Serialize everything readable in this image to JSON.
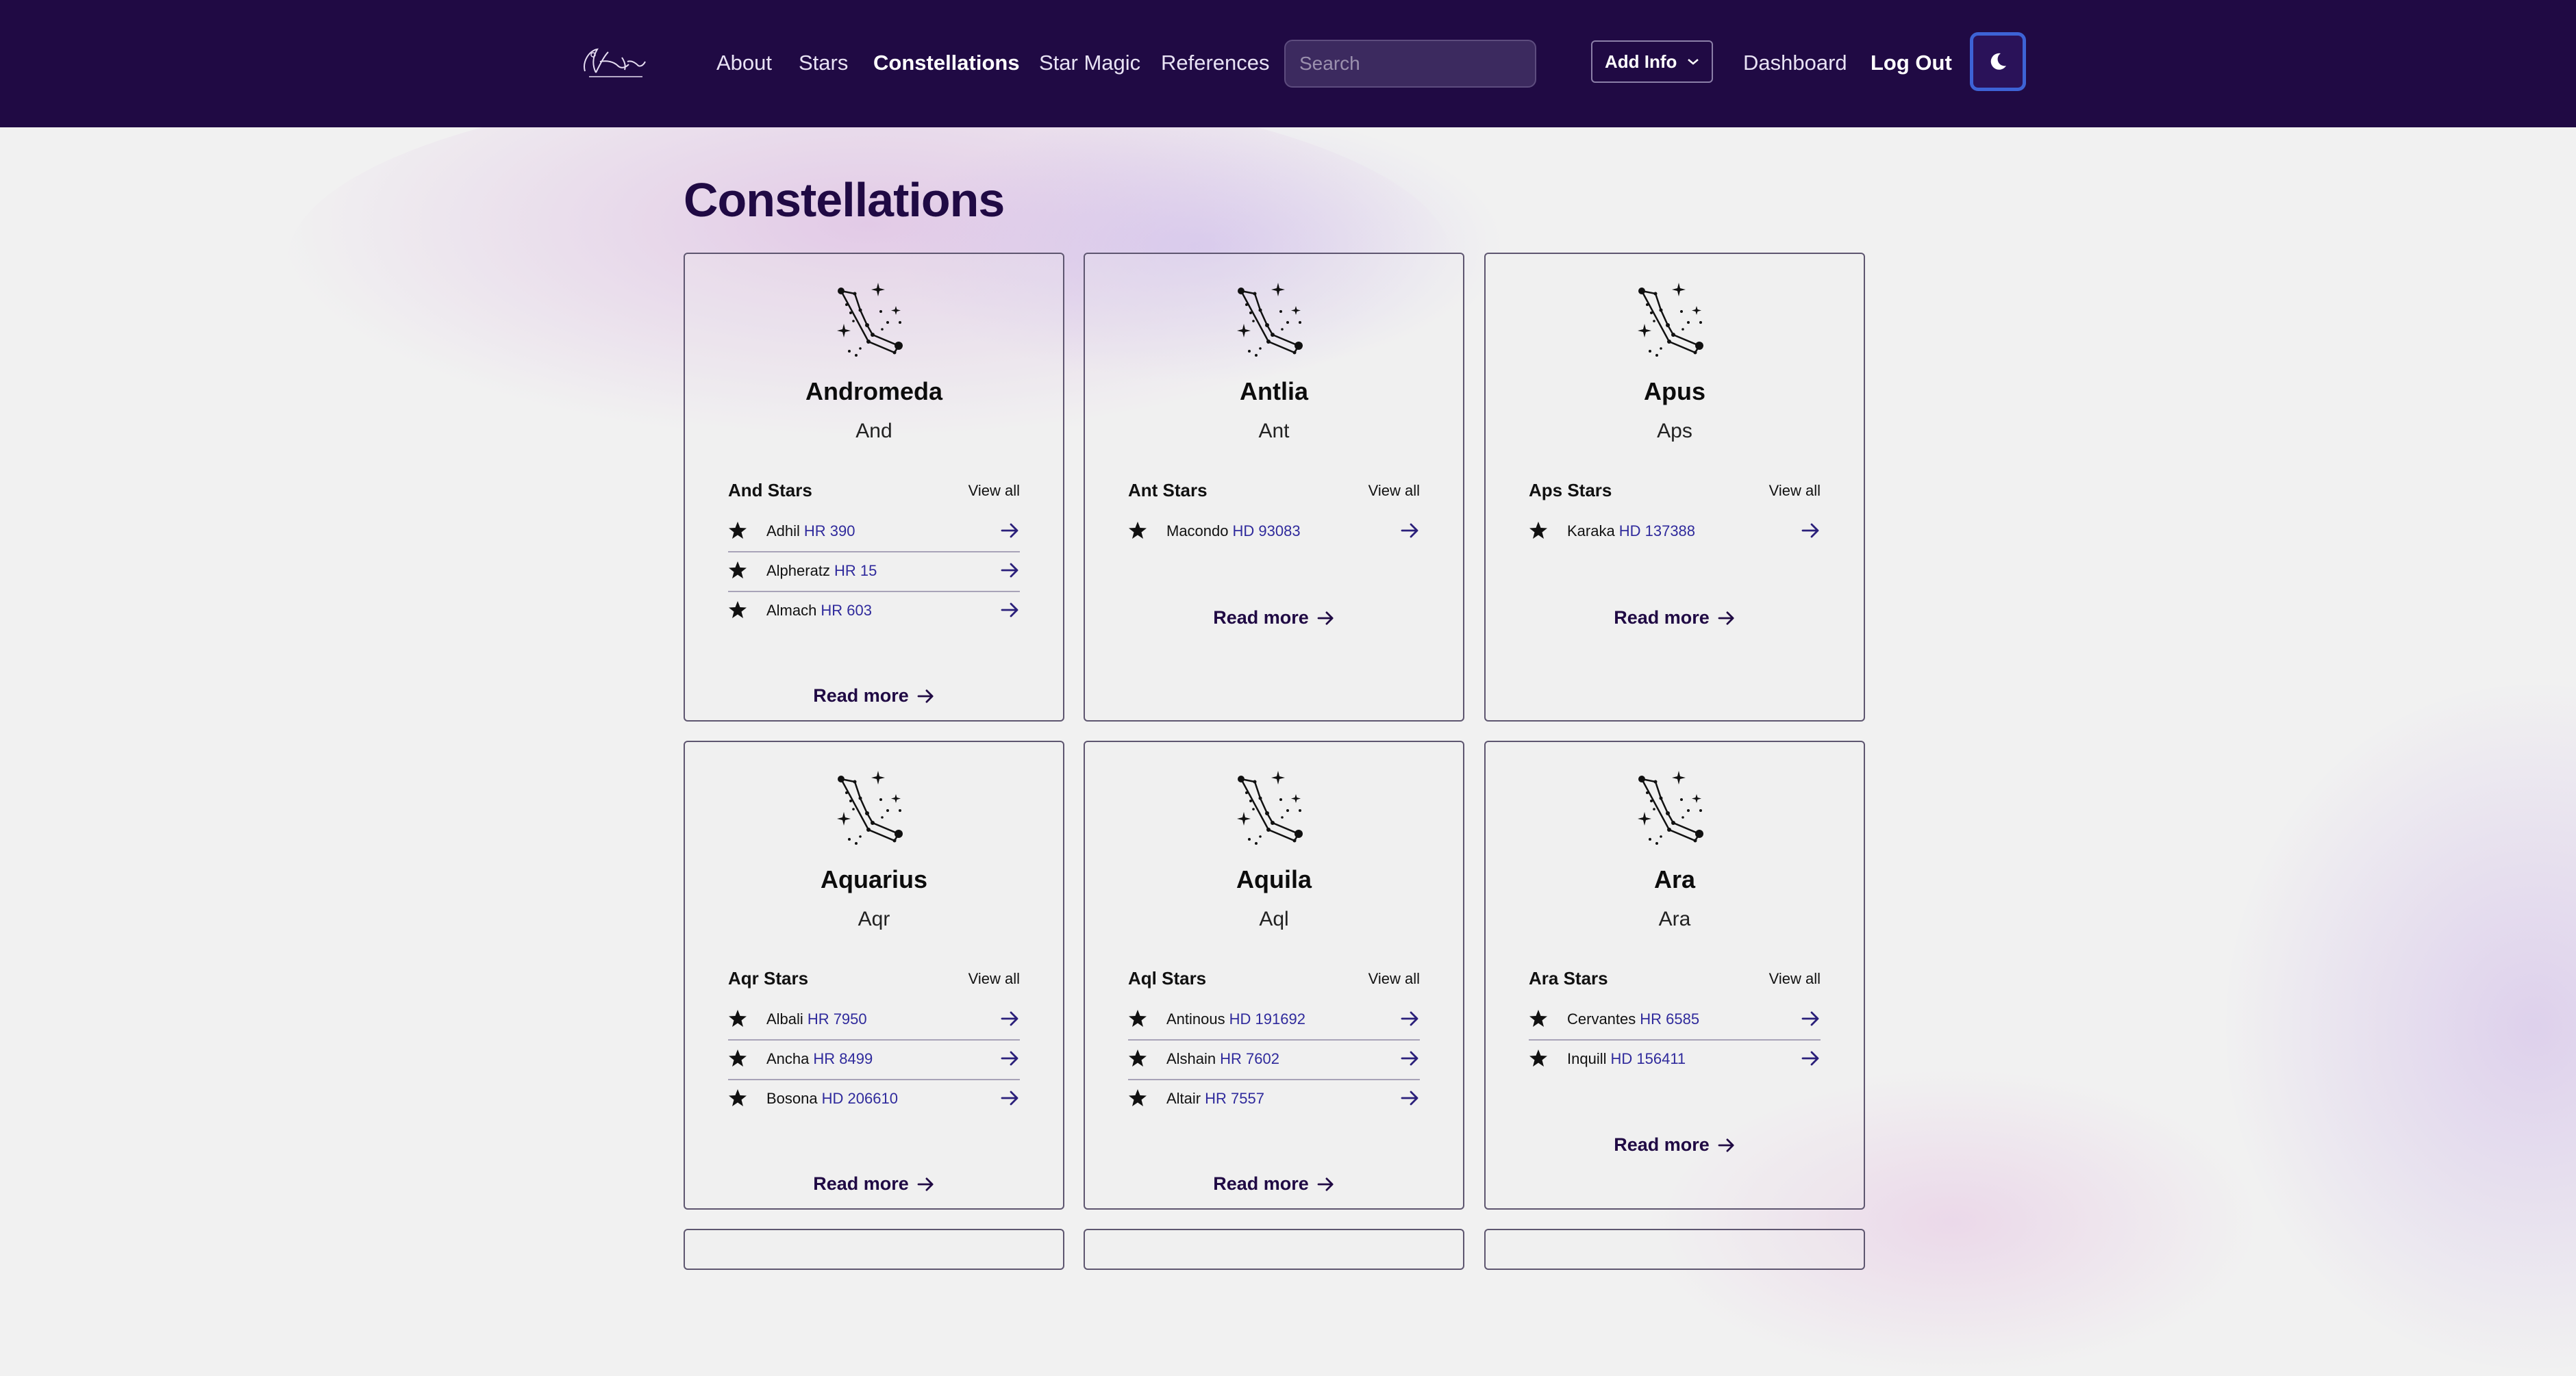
{
  "nav": {
    "links": [
      "About",
      "Stars",
      "Constellations",
      "Star Magic",
      "References"
    ],
    "search_placeholder": "Search",
    "add_info": "Add Info",
    "dashboard": "Dashboard",
    "logout": "Log Out"
  },
  "page": {
    "title": "Constellations"
  },
  "cards": [
    {
      "name": "Andromeda",
      "abbr": "And",
      "stars_title": "And Stars",
      "view_all": "View all",
      "read_more": "Read more",
      "stars": [
        {
          "name": "Adhil",
          "cat": "HR 390"
        },
        {
          "name": "Alpheratz",
          "cat": "HR 15"
        },
        {
          "name": "Almach",
          "cat": "HR 603"
        }
      ]
    },
    {
      "name": "Antlia",
      "abbr": "Ant",
      "stars_title": "Ant Stars",
      "view_all": "View all",
      "read_more": "Read more",
      "stars": [
        {
          "name": "Macondo",
          "cat": "HD 93083"
        }
      ]
    },
    {
      "name": "Apus",
      "abbr": "Aps",
      "stars_title": "Aps Stars",
      "view_all": "View all",
      "read_more": "Read more",
      "stars": [
        {
          "name": "Karaka",
          "cat": "HD 137388"
        }
      ]
    },
    {
      "name": "Aquarius",
      "abbr": "Aqr",
      "stars_title": "Aqr Stars",
      "view_all": "View all",
      "read_more": "Read more",
      "stars": [
        {
          "name": "Albali",
          "cat": "HR 7950"
        },
        {
          "name": "Ancha",
          "cat": "HR 8499"
        },
        {
          "name": "Bosona",
          "cat": "HD 206610"
        }
      ]
    },
    {
      "name": "Aquila",
      "abbr": "Aql",
      "stars_title": "Aql Stars",
      "view_all": "View all",
      "read_more": "Read more",
      "stars": [
        {
          "name": "Antinous",
          "cat": "HD 191692"
        },
        {
          "name": "Alshain",
          "cat": "HR 7602"
        },
        {
          "name": "Altair",
          "cat": "HR 7557"
        }
      ]
    },
    {
      "name": "Ara",
      "abbr": "Ara",
      "stars_title": "Ara Stars",
      "view_all": "View all",
      "read_more": "Read more",
      "stars": [
        {
          "name": "Cervantes",
          "cat": "HR 6585"
        },
        {
          "name": "Inquill",
          "cat": "HD 156411"
        }
      ]
    }
  ],
  "colors": {
    "navbar": "#200a44",
    "accent": "#2f2a9c",
    "toggle_border": "#3d63d6"
  },
  "icons": {
    "logo": "script-logo",
    "dark_mode": "moon-icon",
    "star": "star-icon",
    "arrow": "arrow-right-icon",
    "constellation": "constellation-icon"
  }
}
